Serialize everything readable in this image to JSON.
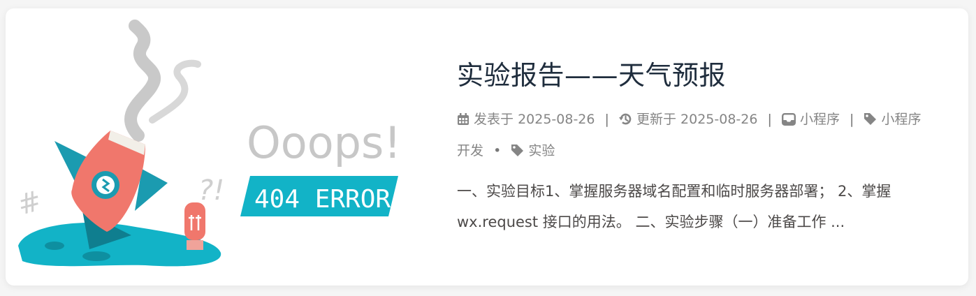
{
  "post": {
    "title": "实验报告——天气预报",
    "published_label": "发表于",
    "published_date": "2025-08-26",
    "updated_label": "更新于",
    "updated_date": "2025-08-26",
    "category": "小程序",
    "tags": [
      "小程序开发",
      "实验"
    ],
    "separator": "|",
    "tag_separator": "•",
    "excerpt": "一、实验目标1、掌握服务器域名配置和临时服务器部署； 2、掌握 wx.request 接口的用法。 二、实验步骤（一）准备工作 ..."
  },
  "cover": {
    "heading": "Ooops!",
    "banner": "404 ERROR",
    "marks": "?!",
    "hash": "#"
  },
  "colors": {
    "title": "#1f2d3d",
    "meta": "#858585",
    "excerpt": "#4c4948",
    "teal": "#12b3c7",
    "rocket": "#f0776c"
  },
  "icons": [
    "calendar-icon",
    "history-icon",
    "inbox-icon",
    "tag-icon"
  ]
}
